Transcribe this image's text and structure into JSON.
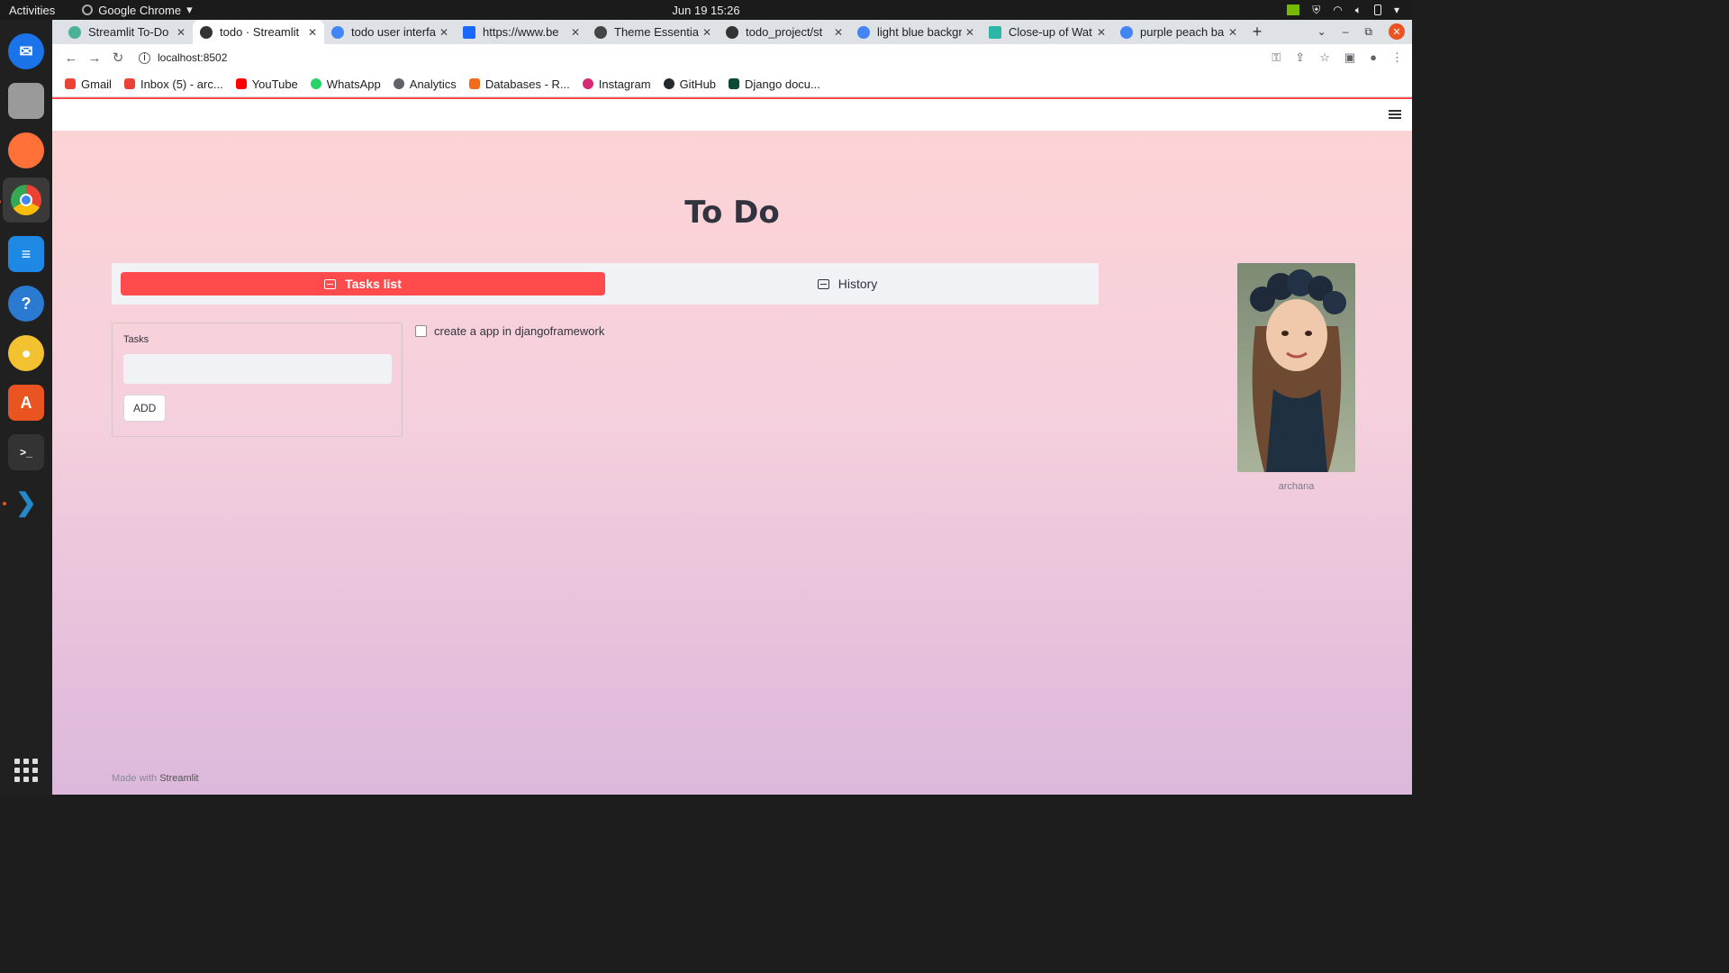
{
  "system": {
    "activities": "Activities",
    "app_menu": "Google Chrome",
    "clock": "Jun 19  15:26"
  },
  "browser": {
    "tabs": [
      {
        "title": "Streamlit To-Do",
        "fav": "#4ab19a"
      },
      {
        "title": "todo · Streamlit",
        "fav": "#333333"
      },
      {
        "title": "todo user interfa",
        "fav": "#4285f4"
      },
      {
        "title": "https://www.be",
        "fav": "#1769ff"
      },
      {
        "title": "Theme Essential",
        "fav": "#444444"
      },
      {
        "title": "todo_project/st",
        "fav": "#333333"
      },
      {
        "title": "light blue backgr",
        "fav": "#4285f4"
      },
      {
        "title": "Close-up of Wat",
        "fav": "#2bb7a3"
      },
      {
        "title": "purple peach ba",
        "fav": "#4285f4"
      }
    ],
    "url": "localhost:8502",
    "bookmarks": [
      {
        "label": "Gmail",
        "color": "#ea4335"
      },
      {
        "label": "Inbox (5) - arc...",
        "color": "#ea4335"
      },
      {
        "label": "YouTube",
        "color": "#ff0000"
      },
      {
        "label": "WhatsApp",
        "color": "#25d366"
      },
      {
        "label": "Analytics",
        "color": "#5f6368"
      },
      {
        "label": "Databases - R...",
        "color": "#f26b1d"
      },
      {
        "label": "Instagram",
        "color": "#d62976"
      },
      {
        "label": "GitHub",
        "color": "#24292e"
      },
      {
        "label": "Django docu...",
        "color": "#0c4b33"
      }
    ]
  },
  "app": {
    "title": "To Do",
    "tabs": {
      "tasks": "Tasks list",
      "history": "History"
    },
    "form": {
      "label": "Tasks",
      "value": "",
      "add_label": "ADD"
    },
    "tasks": [
      {
        "label": "create a app in djangoframework",
        "checked": false
      }
    ],
    "image_caption": "archana",
    "footer_prefix": "Made with",
    "footer_brand": "Streamlit",
    "accent": "#ff4b4b"
  }
}
